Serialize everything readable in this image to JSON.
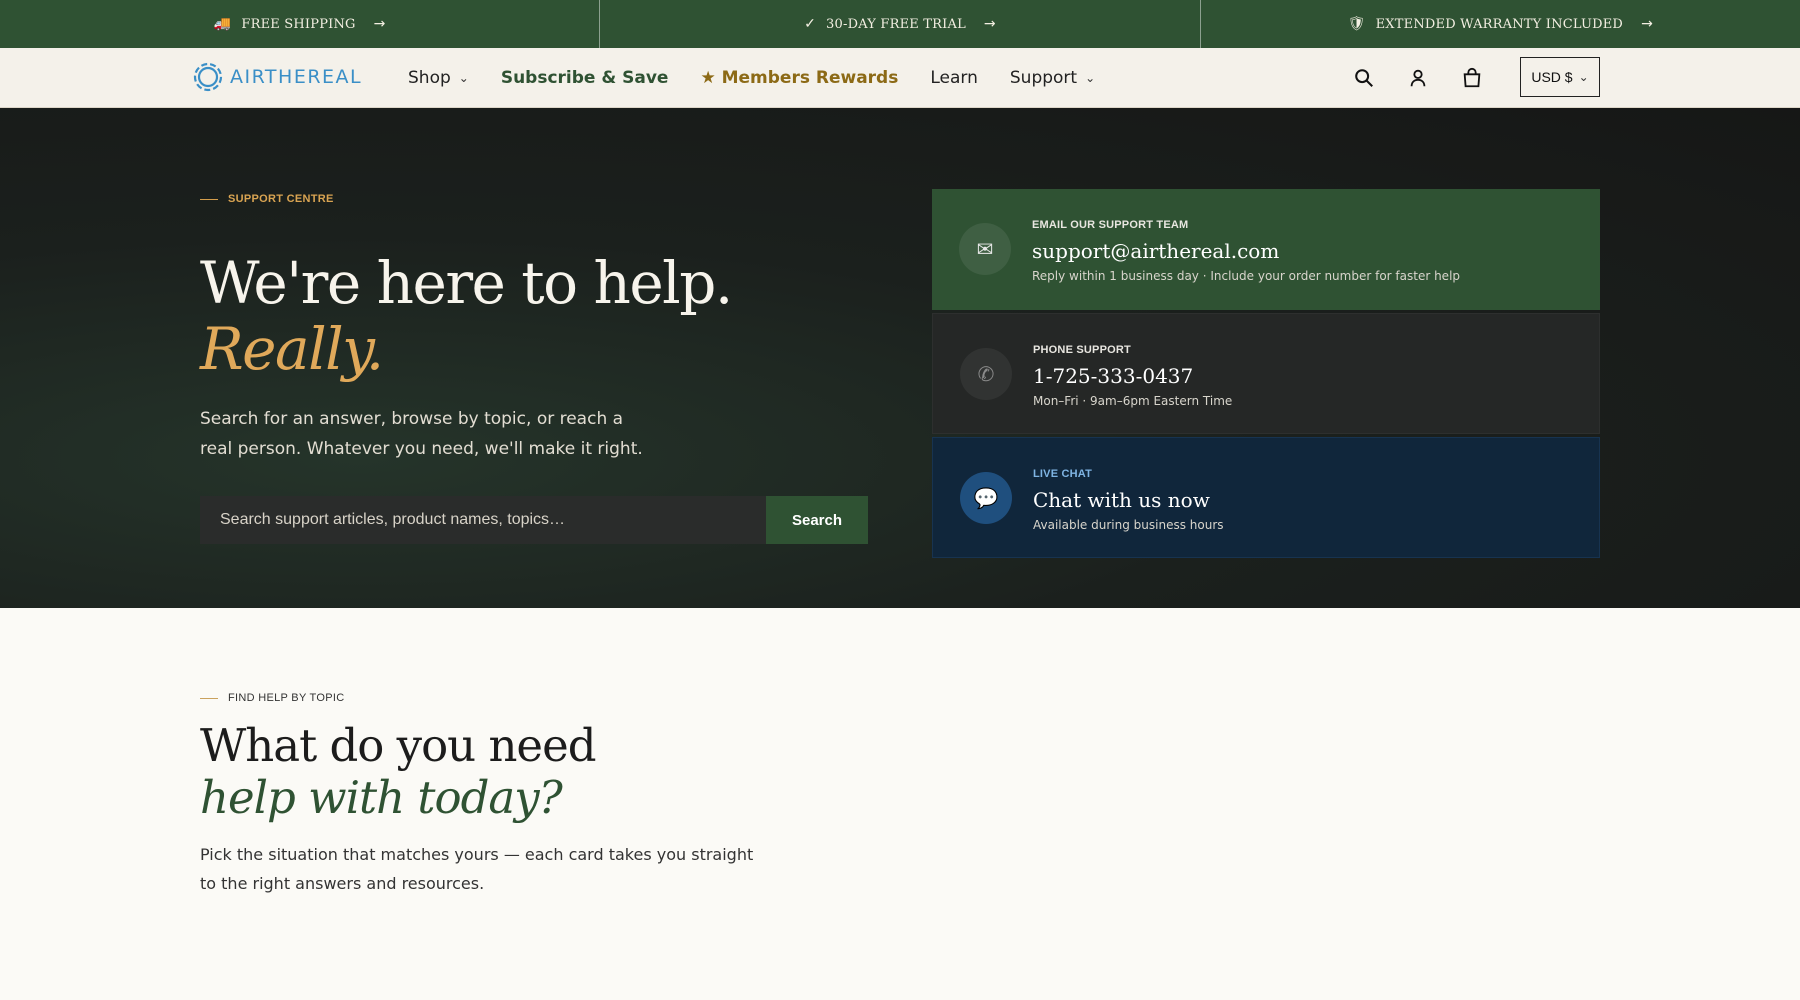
{
  "announcements": [
    {
      "icon": "truck-icon",
      "glyph": "🚚",
      "label": "FREE SHIPPING",
      "arrow": "→"
    },
    {
      "icon": "check-icon",
      "glyph": "✓",
      "label": "30-DAY FREE TRIAL",
      "arrow": "→"
    },
    {
      "icon": "shield-icon",
      "glyph": "🛡",
      "label": "EXTENDED WARRANTY INCLUDED",
      "arrow": "→"
    }
  ],
  "header": {
    "logo_text": "AIRTHEREAL",
    "nav": [
      {
        "label": "Shop",
        "chevron": "⌄"
      },
      {
        "label": "Subscribe & Save"
      },
      {
        "label": "★ Members Rewards"
      },
      {
        "label": "Learn"
      },
      {
        "label": "Support",
        "chevron": "⌄"
      }
    ],
    "currency": "USD $",
    "currency_chevron": "⌄"
  },
  "hero": {
    "eyebrow": "SUPPORT CENTRE",
    "title": "We're here to help.",
    "title_accent": "Really.",
    "subtitle": "Search for an answer, browse by topic, or reach a real person. Whatever you need, we'll make it right.",
    "search_placeholder": "Search support articles, product names, topics…",
    "search_button": "Search"
  },
  "contact": {
    "email": {
      "icon": "envelope-icon",
      "glyph": "✉",
      "label": "EMAIL OUR SUPPORT TEAM",
      "value": "support@airthereal.com",
      "note": "Reply within 1 business day · Include your order number for faster help"
    },
    "phone": {
      "icon": "phone-icon",
      "glyph": "✆",
      "label": "PHONE SUPPORT",
      "value": "1-725-333-0437",
      "note": "Mon–Fri · 9am–6pm Eastern Time"
    },
    "chat": {
      "icon": "chat-bubble-icon",
      "glyph": "💬",
      "label": "LIVE CHAT",
      "value": "Chat with us now",
      "note": "Available during business hours"
    }
  },
  "topics": {
    "eyebrow": "FIND HELP BY TOPIC",
    "title": "What do you need",
    "title_accent": "help with today?",
    "subtitle": "Pick the situation that matches yours — each card takes you straight to the right answers and resources."
  },
  "colors": {
    "brand_green": "#2f5233",
    "gold": "#e0a95a",
    "logo_blue": "#3a8fc7",
    "chat_navy": "#10263b"
  }
}
